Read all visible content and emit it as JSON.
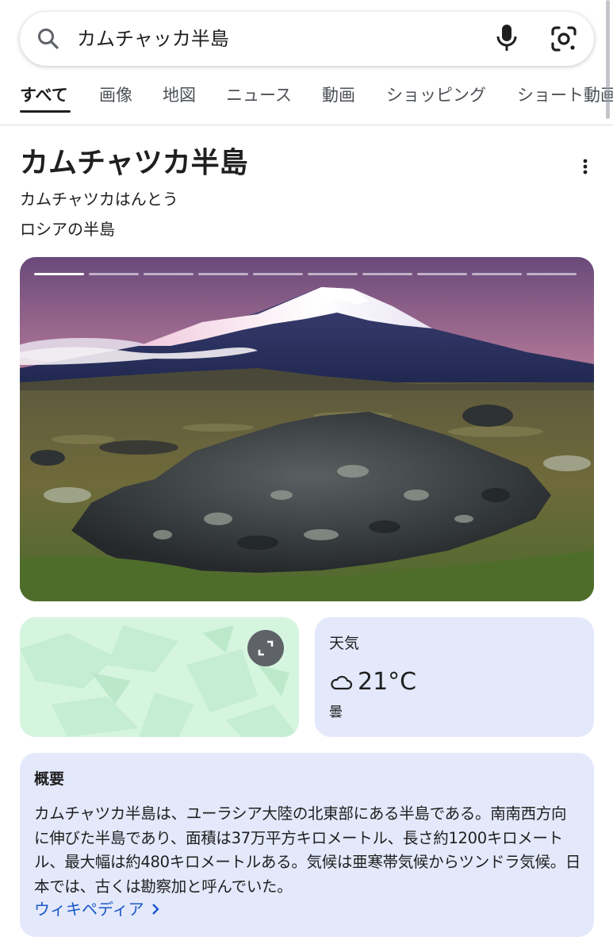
{
  "search": {
    "query": "カムチャッカ半島",
    "icons": [
      "search-icon",
      "mic-icon",
      "lens-icon"
    ]
  },
  "tabs": [
    {
      "label": "すべて",
      "active": true
    },
    {
      "label": "画像",
      "active": false
    },
    {
      "label": "地図",
      "active": false
    },
    {
      "label": "ニュース",
      "active": false
    },
    {
      "label": "動画",
      "active": false
    },
    {
      "label": "ショッピング",
      "active": false
    },
    {
      "label": "ショート動画",
      "active": false
    }
  ],
  "panel": {
    "title": "カムチャツカ半島",
    "reading": "カムチャツカはんとう",
    "subtitle": "ロシアの半島",
    "image_slides": 10
  },
  "weather": {
    "title": "天気",
    "temperature": "21°C",
    "condition": "曇",
    "icon": "cloud-icon"
  },
  "overview": {
    "title": "概要",
    "text": "カムチャツカ半島は、ユーラシア大陸の北東部にある半島である。南南西方向に伸びた半島であり、面積は37万平方キロメートル、長さ約1200キロメートル、最大幅は約480キロメートルある。気候は亜寒帯気候からツンドラ気候。日本では、古くは勘察加と呼んでいた。",
    "link": "ウィキペディア"
  },
  "colors": {
    "link": "#1a57c8",
    "card_bg": "#e3e9fb",
    "map_bg": "#d5f5df"
  }
}
